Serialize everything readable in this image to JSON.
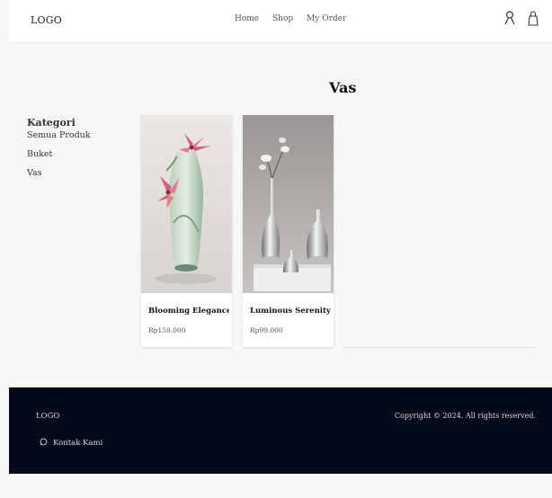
{
  "header": {
    "logo": "LOGO",
    "nav": [
      "Home",
      "Shop",
      "My Order"
    ],
    "icons": [
      "user-icon",
      "bag-icon"
    ]
  },
  "page": {
    "title": "Vas"
  },
  "sidebar": {
    "heading": "Kategori",
    "items": [
      "Semua Produk",
      "Buket",
      "Vas"
    ]
  },
  "products": [
    {
      "name": "Blooming Elegance V...",
      "price": "Rp159.000"
    },
    {
      "name": "Luminous Serenity V...",
      "price": "Rp99.000"
    }
  ],
  "footer": {
    "logo": "LOGO",
    "contact": "Kontak Kami",
    "contact_icon": "whatsapp-icon",
    "copyright": "Copyright © 2024. All rights reserved."
  },
  "colors": {
    "footer_bg": "#050a1a",
    "card_bg": "#ffffff"
  }
}
